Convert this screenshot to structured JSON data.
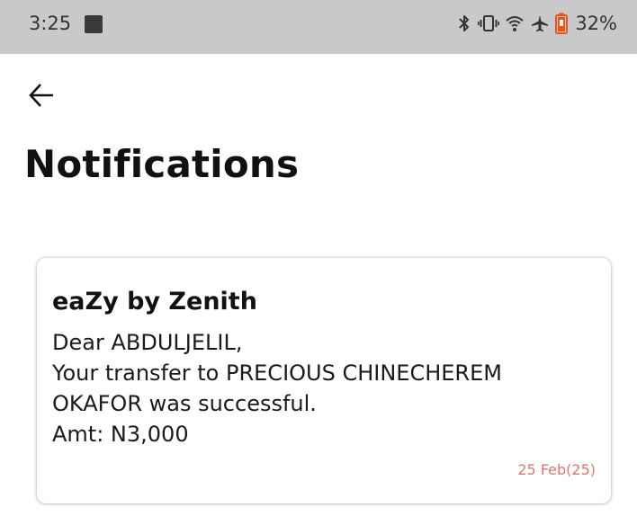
{
  "status_bar": {
    "time": "3:25",
    "battery_percent": "32%",
    "icons": [
      "bluetooth-icon",
      "vibrate-icon",
      "wifi-icon",
      "airplane-icon",
      "battery-icon"
    ],
    "battery_color": "#e8541c"
  },
  "header": {
    "back_icon": "arrow-left-icon",
    "title": "Notifications"
  },
  "notifications": [
    {
      "sender": "eaZy by Zenith",
      "message": "Dear ABDULJELIL,\nYour transfer to PRECIOUS CHINECHEREM OKAFOR was successful.\n Amt: N3,000",
      "date": "25 Feb(25)"
    }
  ],
  "colors": {
    "status_bar_bg": "#c9c9c9",
    "date_text": "#d77a74"
  }
}
